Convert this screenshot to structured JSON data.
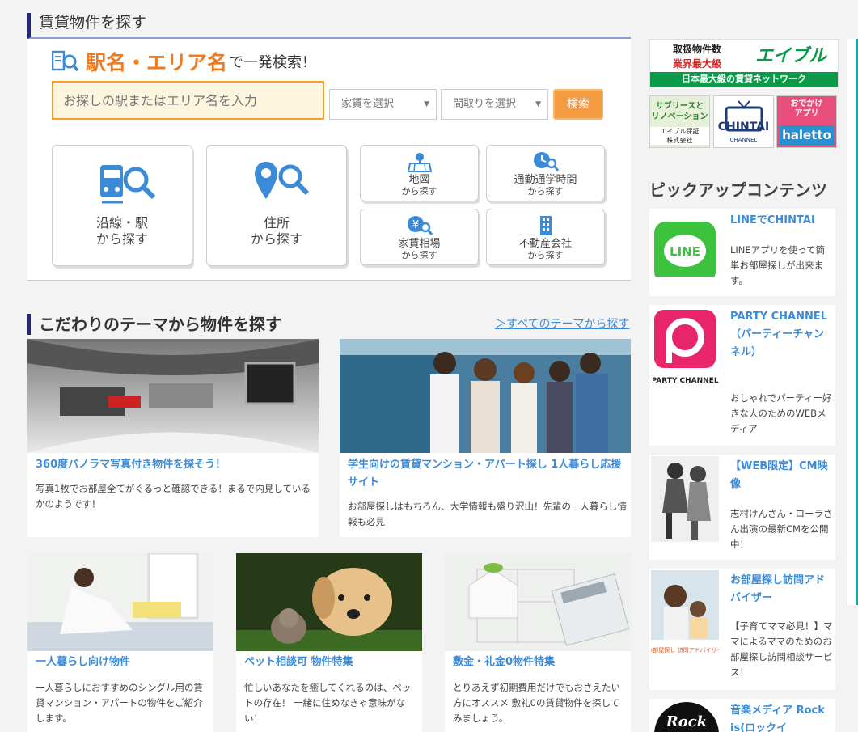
{
  "search_section": {
    "heading": "賃貸物件を探す",
    "tagline_em": "駅名・エリア名",
    "tagline_rest": "で一発検索！",
    "keyword_placeholder": "お探しの駅またはエリア名を入力",
    "rent_select": "家賃を選択",
    "layout_select": "間取りを選択",
    "search_button": "検索",
    "big_buttons": [
      {
        "label1": "沿線・駅",
        "label2": "から探す"
      },
      {
        "label1": "住所",
        "label2": "から探す"
      }
    ],
    "small_buttons": [
      {
        "label": "地図",
        "sub": "から探す"
      },
      {
        "label": "通勤通学時間",
        "sub": "から探す"
      },
      {
        "label": "家賃相場",
        "sub": "から探す"
      },
      {
        "label": "不動産会社",
        "sub": "から探す"
      }
    ]
  },
  "theme_section": {
    "heading": "こだわりのテーマから物件を探す",
    "all_link": "＞すべてのテーマから探す",
    "cards": [
      {
        "title": "360度パノラマ写真付き物件を探そう！",
        "text": "写真1枚でお部屋全てがぐるっと確認できる！まるで内見しているかのようです！"
      },
      {
        "title": "学生向けの賃貸マンション・アパート探し 1人暮らし応援サイト",
        "text": "お部屋探しはもちろん、大学情報も盛り沢山！先輩の一人暮らし情報も必見"
      },
      {
        "title": "一人暮らし向け物件",
        "text": "一人暮らしにおすすめのシングル用の賃貸マンション・アパートの物件をご紹介します。"
      },
      {
        "title": "ペット相談可 物件特集",
        "text": "忙しいあなたを癒してくれるのは、ペットの存在！ 一緒に住めなきゃ意味がない！"
      },
      {
        "title": "敷金・礼金0物件特集",
        "text": "とりあえず初期費用だけでもおさえたい方にオススメ 敷礼0の賃貸物件を探してみましょう。"
      }
    ]
  },
  "sidebar": {
    "able_banner": {
      "line1": "取扱物件数",
      "line2": "業界最大級",
      "brand": "エイブル",
      "tagline": "日本最大級の賃貸ネットワーク"
    },
    "square_banners": [
      {
        "line1": "サブリースと",
        "line2": "リノベーション",
        "line3": "エイブル保証",
        "line4": "株式会社"
      },
      {
        "brand": "CHINTAI",
        "sub": "CHANNEL"
      },
      {
        "line1": "おでかけ",
        "line2": "アプリ",
        "brand": "haletto"
      }
    ],
    "pickup_heading": "ピックアップコンテンツ",
    "pickups": [
      {
        "title": "LINEでCHINTAI",
        "text": "LINEアプリを使って簡単お部屋探しが出来ます。",
        "thumb_label": "LINE"
      },
      {
        "title": "PARTY CHANNEL（パーティーチャンネル）",
        "text": "おしゃれでパーティー好きな人のためのWEBメディア",
        "thumb_label": "PARTY CHANNEL"
      },
      {
        "title": "【WEB限定】CM映像",
        "text": "志村けんさん・ローラさん出演の最新CMを公開中！"
      },
      {
        "title": "お部屋探し訪問アドバイザー",
        "text": "【子育てママ必見！】ママによるママのためのお部屋探し訪問相談サービス！",
        "thumb_label": "お部屋探し 訪問アドバイザー"
      },
      {
        "title": "音楽メディア Rock is(ロックイ",
        "thumb_label": "Rock"
      }
    ]
  },
  "colors": {
    "accent_orange": "#f07b1e",
    "link_blue": "#3b8bd8",
    "heading_bar": "#1e2a78",
    "able_green": "#0a9a4a"
  }
}
